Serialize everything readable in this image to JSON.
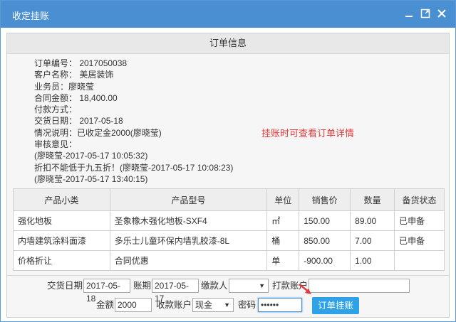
{
  "window": {
    "title": "收定挂账"
  },
  "section": {
    "title": "订单信息"
  },
  "info": {
    "order_no": "订单编号： 2017050038",
    "customer": "客户名称： 美居装饰",
    "salesman": "业务员：廖晓莹",
    "contract_amount": "合同金额： 18,400.00",
    "payment_method": "付款方式：",
    "delivery_date": "交货日期： 2017-05-18",
    "status_note": "情况说明：已收定金2000(廖晓莹)",
    "review_label": "审核意见：",
    "review_1": "(廖晓莹-2017-05-17 10:05:32)",
    "review_2": "折扣不能低于九五折！(廖晓莹-2017-05-17 10:08:23)",
    "review_3": "(廖晓莹-2017-05-17 13:40:15)"
  },
  "annotation": "挂账时可查看订单详情",
  "table": {
    "headers": [
      "产品小类",
      "产品型号",
      "单位",
      "销售价",
      "数量",
      "备货状态"
    ],
    "rows": [
      [
        "强化地板",
        "圣象橡木强化地板-SXF4",
        "㎡",
        "150.00",
        "89.00",
        "已申备"
      ],
      [
        "内墙建筑涂料面漆",
        "多乐士儿童环保内墙乳胶漆-8L",
        "桶",
        "850.00",
        "7.00",
        "已申备"
      ],
      [
        "价格折让",
        "合同优惠",
        "单",
        "-900.00",
        "1.00",
        ""
      ]
    ]
  },
  "form": {
    "delivery_label": "交货日期",
    "delivery_value": "2017-05-18",
    "account_period_label": "账期",
    "account_period_value": "2017-05-17",
    "payer_label": "缴款人",
    "payer_value": "",
    "pay_account_label": "打款账户",
    "pay_account_value": "",
    "amount_label": "金额",
    "amount_value": "2000",
    "receive_account_label": "收款账户",
    "receive_account_value": "现金",
    "password_label": "密码",
    "password_value": "••••••",
    "submit_label": "订单挂账"
  },
  "colors": {
    "titlebar": "#4a8fd1",
    "button": "#2fa1e6",
    "annotation": "#e23a3a"
  }
}
